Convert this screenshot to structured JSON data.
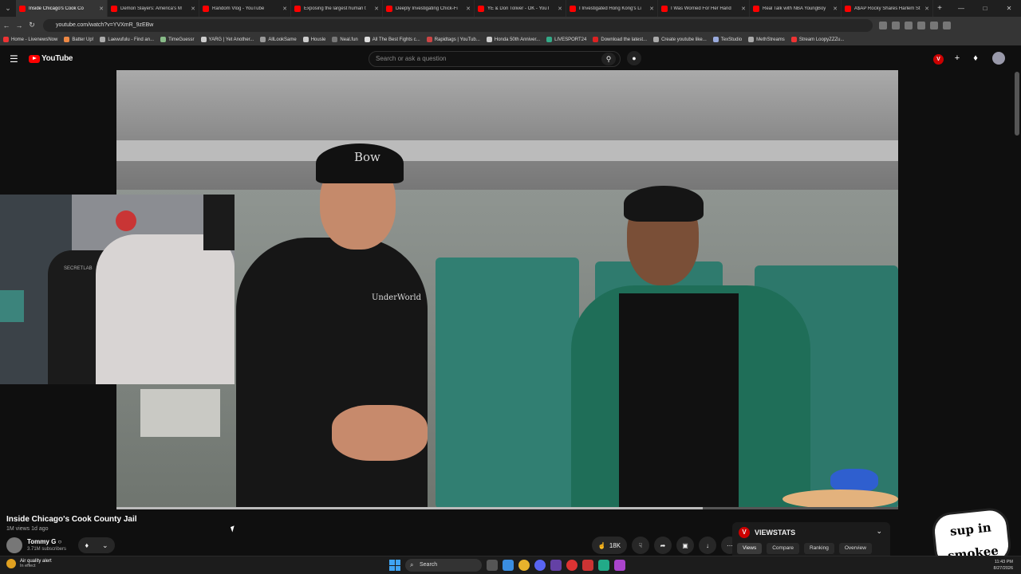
{
  "browser": {
    "tabs": [
      {
        "title": "Inside Chicago's Cook Co",
        "active": true
      },
      {
        "title": "Demon Slayers: America's M",
        "active": false
      },
      {
        "title": "Random Vlog - YouTube",
        "active": false
      },
      {
        "title": "Exposing the largest human t",
        "active": false
      },
      {
        "title": "Deeply Investigating Chick-Fi",
        "active": false
      },
      {
        "title": "YE & Don Toliver - OK - YouT",
        "active": false
      },
      {
        "title": "I Investigated Hong Kong's Li",
        "active": false
      },
      {
        "title": "I Was Worried For Her Hand",
        "active": false
      },
      {
        "title": "Real Talk with NBA YoungBoy",
        "active": false
      },
      {
        "title": "A$AP Rocky Shares Harlem St",
        "active": false
      }
    ],
    "url": "youtube.com/watch?v=YVXmR_9zEBw",
    "bookmarks": [
      "Home - LivenewsNow",
      "Batter Up!",
      "Laewufulu - Find an...",
      "TimeGuessr",
      "YARG | Yet Another...",
      "AllLookSame",
      "Housle",
      "Neal.fun",
      "All The Best Fights c...",
      "Rapidtags | YouTub...",
      "Honda 50th Anniver...",
      "LIVESPORT24",
      "Download the latest...",
      "Create youtube like...",
      "TexStudio",
      "MethStreams",
      "Stream LoopyZZZu..."
    ]
  },
  "youtube": {
    "logo_text": "YouTube",
    "search_placeholder": "Search or ask a question",
    "viewstats_badge": "V"
  },
  "video": {
    "title": "Inside Chicago's Cook County Jail",
    "meta": "1M views  1d ago",
    "channel_name": "Tommy G ○",
    "channel_subs": "3.71M subscribers",
    "likes": "18K",
    "progress": 0.75,
    "cap_logo": "Bow",
    "shirt_logo": "UnderWorld"
  },
  "viewstats": {
    "logo": "V",
    "title": "VIEWSTATS",
    "tabs": [
      "Views",
      "Compare",
      "Ranking",
      "Overview"
    ]
  },
  "overlay_logo": "sup in smokee",
  "webcam": {
    "chair_text": "SECRETLAB"
  },
  "taskbar": {
    "weather_title": "Air quality alert",
    "weather_sub": "In effect",
    "search_label": "Search",
    "time": "11:43 PM",
    "date": "8/27/2026"
  },
  "colors": {
    "youtube_red": "#ff0000",
    "background": "#0f0f0f"
  }
}
